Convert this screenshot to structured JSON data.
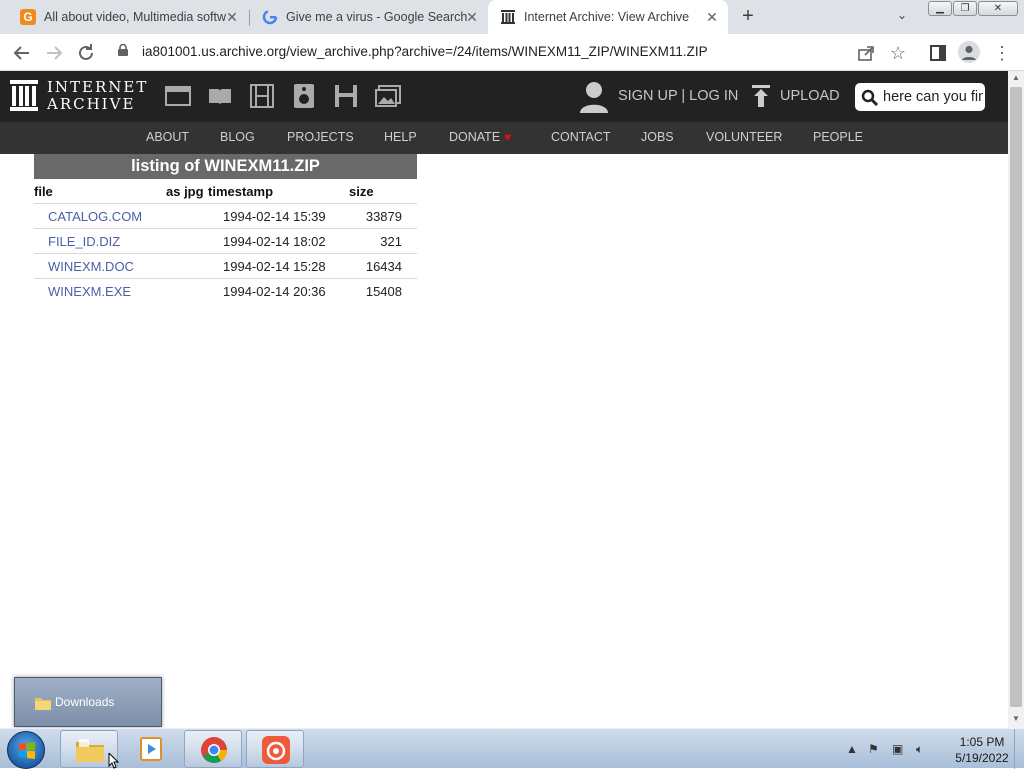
{
  "browser": {
    "tabs": [
      {
        "title": "All about video, Multimedia softw",
        "favicon": "orange-g-icon"
      },
      {
        "title": "Give me a virus - Google Search",
        "favicon": "google-g-icon"
      },
      {
        "title": "Internet Archive: View Archive",
        "favicon": "archive-icon"
      }
    ],
    "new_tab_label": "+",
    "url": "ia801001.us.archive.org/view_archive.php?archive=/24/items/WINEXM11_ZIP/WINEXM11.ZIP"
  },
  "ia_header": {
    "logo_line1": "INTERNET",
    "logo_line2": "ARCHIVE",
    "signup_login": "SIGN UP | LOG IN",
    "upload": "UPLOAD",
    "search_value": "here can you fin",
    "nav": [
      "ABOUT",
      "BLOG",
      "PROJECTS",
      "HELP",
      "DONATE",
      "CONTACT",
      "JOBS",
      "VOLUNTEER",
      "PEOPLE"
    ]
  },
  "listing": {
    "title": "listing of WINEXM11.ZIP",
    "columns": {
      "file": "file",
      "as_jpg": "as jpg",
      "timestamp": "timestamp",
      "size": "size"
    },
    "rows": [
      {
        "file": "CATALOG.COM",
        "timestamp": "1994-02-14 15:39",
        "size": "33879"
      },
      {
        "file": "FILE_ID.DIZ",
        "timestamp": "1994-02-14 18:02",
        "size": "321"
      },
      {
        "file": "WINEXM.DOC",
        "timestamp": "1994-02-14 15:28",
        "size": "16434"
      },
      {
        "file": "WINEXM.EXE",
        "timestamp": "1994-02-14 20:36",
        "size": "15408"
      }
    ]
  },
  "downloads_popup": {
    "label": "Downloads"
  },
  "taskbar": {
    "time": "1:05 PM",
    "date": "5/19/2022"
  },
  "colors": {
    "ia_header_bg": "#222222",
    "ia_nav_bg": "#333333",
    "link": "#4a60a8",
    "listing_header_bg": "#696969"
  }
}
